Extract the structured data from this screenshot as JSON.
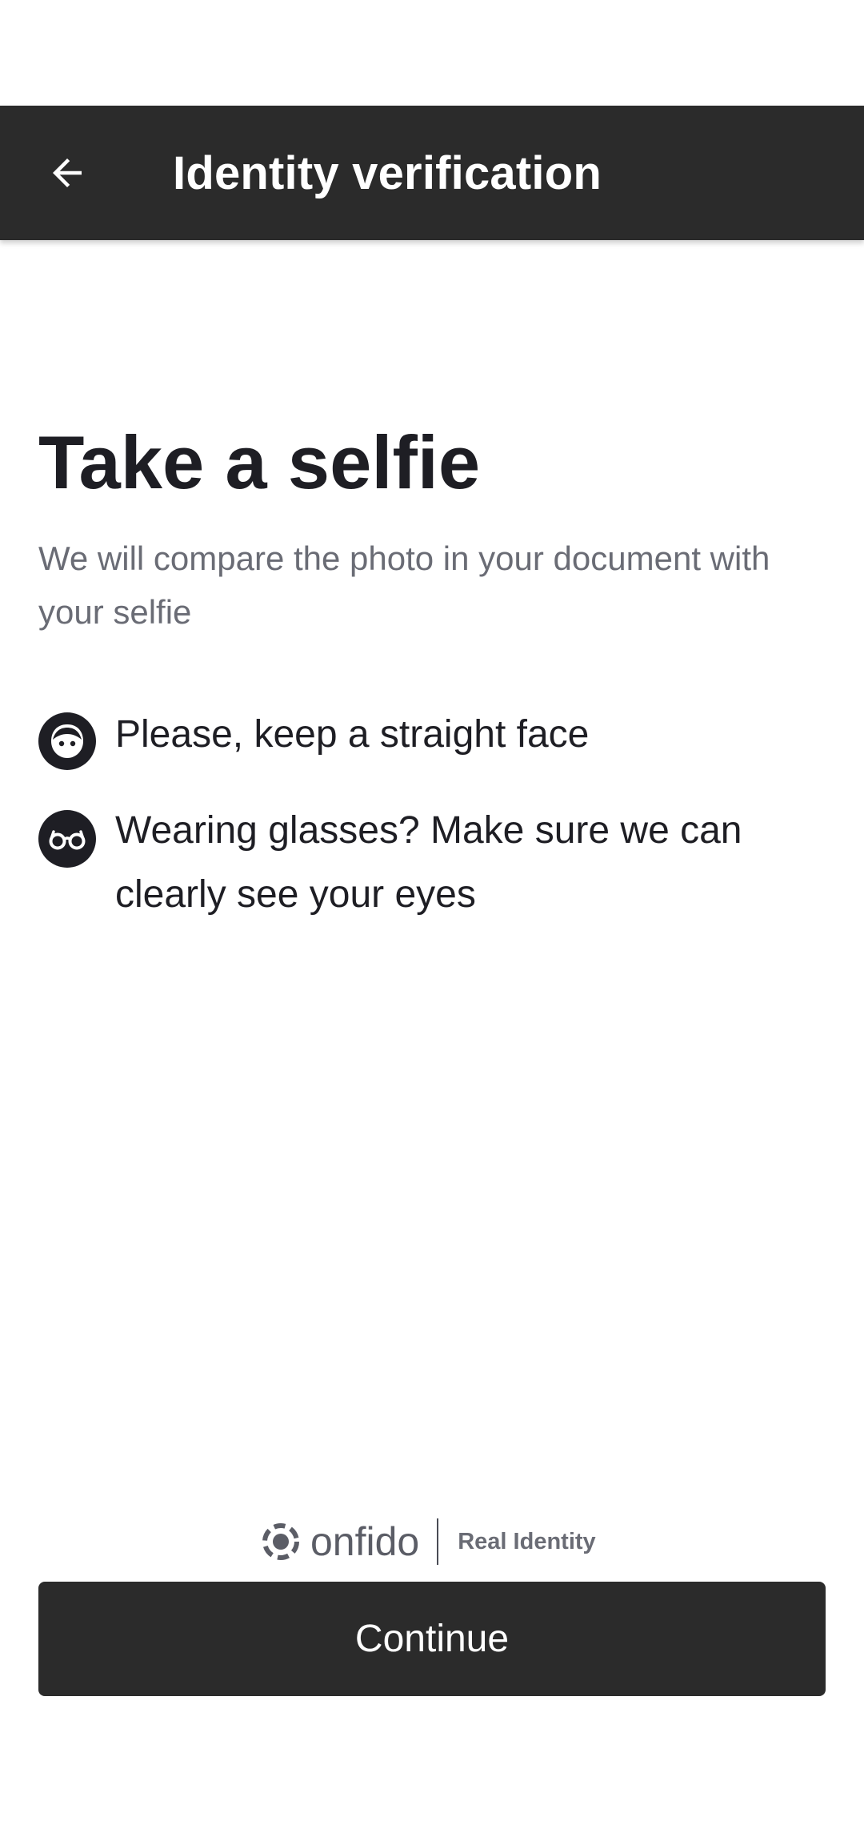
{
  "app_bar": {
    "title": "Identity verification",
    "back_icon": "arrow-left-icon"
  },
  "main": {
    "headline": "Take a selfie",
    "subtitle": "We will compare the photo in your document with your selfie",
    "instructions": [
      {
        "icon": "face-icon",
        "text": "Please, keep a straight face"
      },
      {
        "icon": "glasses-icon",
        "text": "Wearing glasses? Make sure we can clearly see your eyes"
      }
    ]
  },
  "footer": {
    "brand_name": "onfido",
    "brand_tagline": "Real Identity",
    "continue_label": "Continue"
  },
  "colors": {
    "app_bar_bg": "#2b2b2b",
    "button_bg": "#2b2b2b",
    "headline_text": "#1e1e24",
    "secondary_text": "#6a6c75"
  }
}
